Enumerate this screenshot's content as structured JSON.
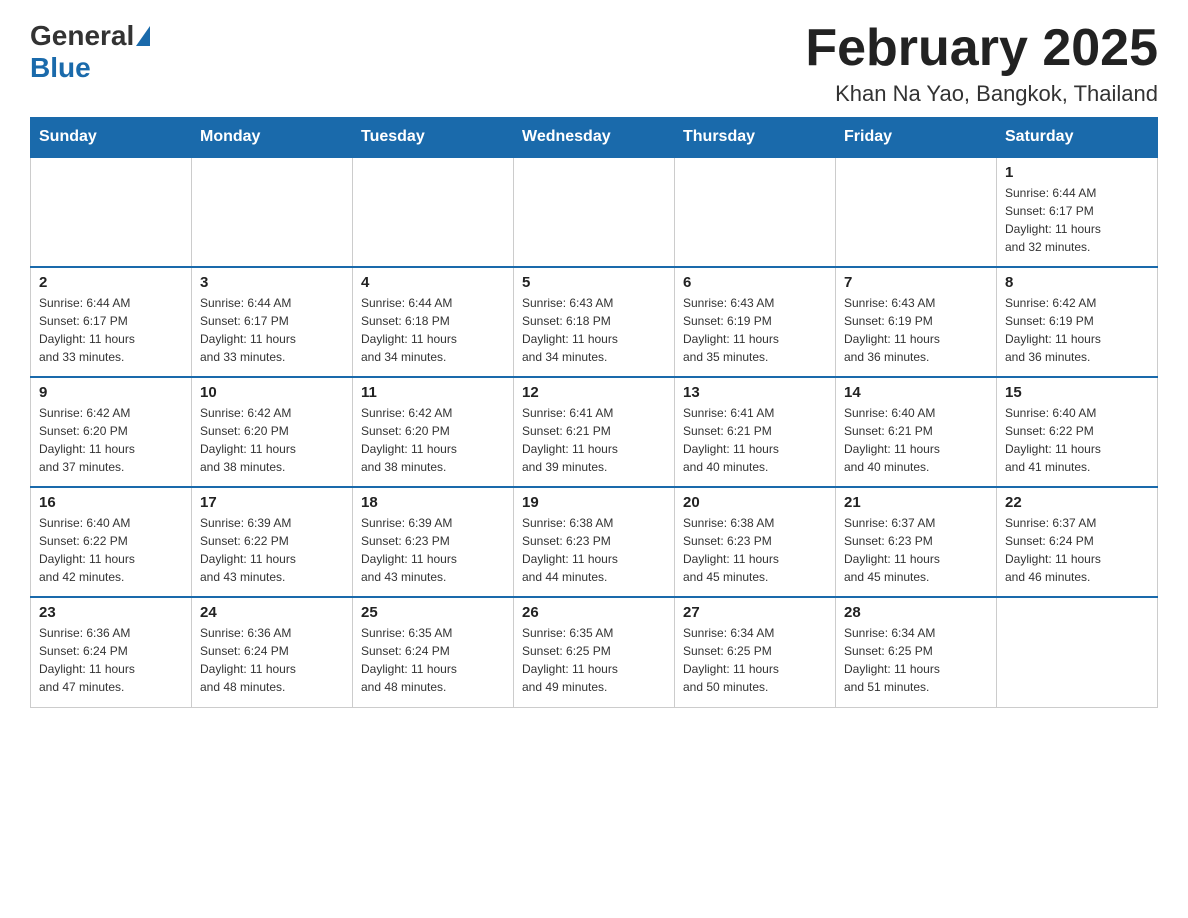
{
  "logo": {
    "general": "General",
    "blue": "Blue"
  },
  "header": {
    "title": "February 2025",
    "location": "Khan Na Yao, Bangkok, Thailand"
  },
  "days_of_week": [
    "Sunday",
    "Monday",
    "Tuesday",
    "Wednesday",
    "Thursday",
    "Friday",
    "Saturday"
  ],
  "weeks": [
    [
      {
        "day": "",
        "info": ""
      },
      {
        "day": "",
        "info": ""
      },
      {
        "day": "",
        "info": ""
      },
      {
        "day": "",
        "info": ""
      },
      {
        "day": "",
        "info": ""
      },
      {
        "day": "",
        "info": ""
      },
      {
        "day": "1",
        "info": "Sunrise: 6:44 AM\nSunset: 6:17 PM\nDaylight: 11 hours\nand 32 minutes."
      }
    ],
    [
      {
        "day": "2",
        "info": "Sunrise: 6:44 AM\nSunset: 6:17 PM\nDaylight: 11 hours\nand 33 minutes."
      },
      {
        "day": "3",
        "info": "Sunrise: 6:44 AM\nSunset: 6:17 PM\nDaylight: 11 hours\nand 33 minutes."
      },
      {
        "day": "4",
        "info": "Sunrise: 6:44 AM\nSunset: 6:18 PM\nDaylight: 11 hours\nand 34 minutes."
      },
      {
        "day": "5",
        "info": "Sunrise: 6:43 AM\nSunset: 6:18 PM\nDaylight: 11 hours\nand 34 minutes."
      },
      {
        "day": "6",
        "info": "Sunrise: 6:43 AM\nSunset: 6:19 PM\nDaylight: 11 hours\nand 35 minutes."
      },
      {
        "day": "7",
        "info": "Sunrise: 6:43 AM\nSunset: 6:19 PM\nDaylight: 11 hours\nand 36 minutes."
      },
      {
        "day": "8",
        "info": "Sunrise: 6:42 AM\nSunset: 6:19 PM\nDaylight: 11 hours\nand 36 minutes."
      }
    ],
    [
      {
        "day": "9",
        "info": "Sunrise: 6:42 AM\nSunset: 6:20 PM\nDaylight: 11 hours\nand 37 minutes."
      },
      {
        "day": "10",
        "info": "Sunrise: 6:42 AM\nSunset: 6:20 PM\nDaylight: 11 hours\nand 38 minutes."
      },
      {
        "day": "11",
        "info": "Sunrise: 6:42 AM\nSunset: 6:20 PM\nDaylight: 11 hours\nand 38 minutes."
      },
      {
        "day": "12",
        "info": "Sunrise: 6:41 AM\nSunset: 6:21 PM\nDaylight: 11 hours\nand 39 minutes."
      },
      {
        "day": "13",
        "info": "Sunrise: 6:41 AM\nSunset: 6:21 PM\nDaylight: 11 hours\nand 40 minutes."
      },
      {
        "day": "14",
        "info": "Sunrise: 6:40 AM\nSunset: 6:21 PM\nDaylight: 11 hours\nand 40 minutes."
      },
      {
        "day": "15",
        "info": "Sunrise: 6:40 AM\nSunset: 6:22 PM\nDaylight: 11 hours\nand 41 minutes."
      }
    ],
    [
      {
        "day": "16",
        "info": "Sunrise: 6:40 AM\nSunset: 6:22 PM\nDaylight: 11 hours\nand 42 minutes."
      },
      {
        "day": "17",
        "info": "Sunrise: 6:39 AM\nSunset: 6:22 PM\nDaylight: 11 hours\nand 43 minutes."
      },
      {
        "day": "18",
        "info": "Sunrise: 6:39 AM\nSunset: 6:23 PM\nDaylight: 11 hours\nand 43 minutes."
      },
      {
        "day": "19",
        "info": "Sunrise: 6:38 AM\nSunset: 6:23 PM\nDaylight: 11 hours\nand 44 minutes."
      },
      {
        "day": "20",
        "info": "Sunrise: 6:38 AM\nSunset: 6:23 PM\nDaylight: 11 hours\nand 45 minutes."
      },
      {
        "day": "21",
        "info": "Sunrise: 6:37 AM\nSunset: 6:23 PM\nDaylight: 11 hours\nand 45 minutes."
      },
      {
        "day": "22",
        "info": "Sunrise: 6:37 AM\nSunset: 6:24 PM\nDaylight: 11 hours\nand 46 minutes."
      }
    ],
    [
      {
        "day": "23",
        "info": "Sunrise: 6:36 AM\nSunset: 6:24 PM\nDaylight: 11 hours\nand 47 minutes."
      },
      {
        "day": "24",
        "info": "Sunrise: 6:36 AM\nSunset: 6:24 PM\nDaylight: 11 hours\nand 48 minutes."
      },
      {
        "day": "25",
        "info": "Sunrise: 6:35 AM\nSunset: 6:24 PM\nDaylight: 11 hours\nand 48 minutes."
      },
      {
        "day": "26",
        "info": "Sunrise: 6:35 AM\nSunset: 6:25 PM\nDaylight: 11 hours\nand 49 minutes."
      },
      {
        "day": "27",
        "info": "Sunrise: 6:34 AM\nSunset: 6:25 PM\nDaylight: 11 hours\nand 50 minutes."
      },
      {
        "day": "28",
        "info": "Sunrise: 6:34 AM\nSunset: 6:25 PM\nDaylight: 11 hours\nand 51 minutes."
      },
      {
        "day": "",
        "info": ""
      }
    ]
  ]
}
